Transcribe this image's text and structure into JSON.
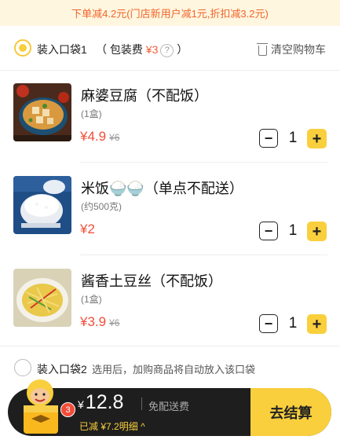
{
  "banner": {
    "text": "下单减4.2元(门店新用户减1元,折扣减3.2元)"
  },
  "bag1": {
    "label": "装入口袋1",
    "packing_prefix": "（ 包装费 ",
    "packing_fee": "¥3",
    "packing_suffix": " ）",
    "help_glyph": "?",
    "clear_cart": "清空购物车"
  },
  "items": [
    {
      "name": "麻婆豆腐（不配饭）",
      "spec": "(1盒)",
      "price": "¥4.9",
      "original_price": "¥6",
      "qty": "1",
      "minus": "−",
      "plus": "+"
    },
    {
      "name": "米饭🍚🍚（单点不配送）",
      "spec": "(约500克)",
      "price": "¥2",
      "original_price": "",
      "qty": "1",
      "minus": "−",
      "plus": "+"
    },
    {
      "name": "酱香土豆丝（不配饭）",
      "spec": "(1盒)",
      "price": "¥3.9",
      "original_price": "¥6",
      "qty": "1",
      "minus": "−",
      "plus": "+"
    }
  ],
  "bag2": {
    "label": "装入口袋2",
    "hint": "选用后，加购商品将自动放入该口袋"
  },
  "checkout": {
    "currency": "¥",
    "total": "12.8",
    "free_shipping": "免配送费",
    "discount_label": "已减",
    "discount_amount": "¥7.2",
    "detail": "明细",
    "detail_icon": "^",
    "cart_count": "3",
    "button": "去结算"
  },
  "colors": {
    "accent": "#f9cf3d",
    "price_red": "#f24d3a",
    "banner_bg": "#fff6df",
    "banner_text": "#f0642b",
    "bar_bg": "#1e1e1e"
  }
}
